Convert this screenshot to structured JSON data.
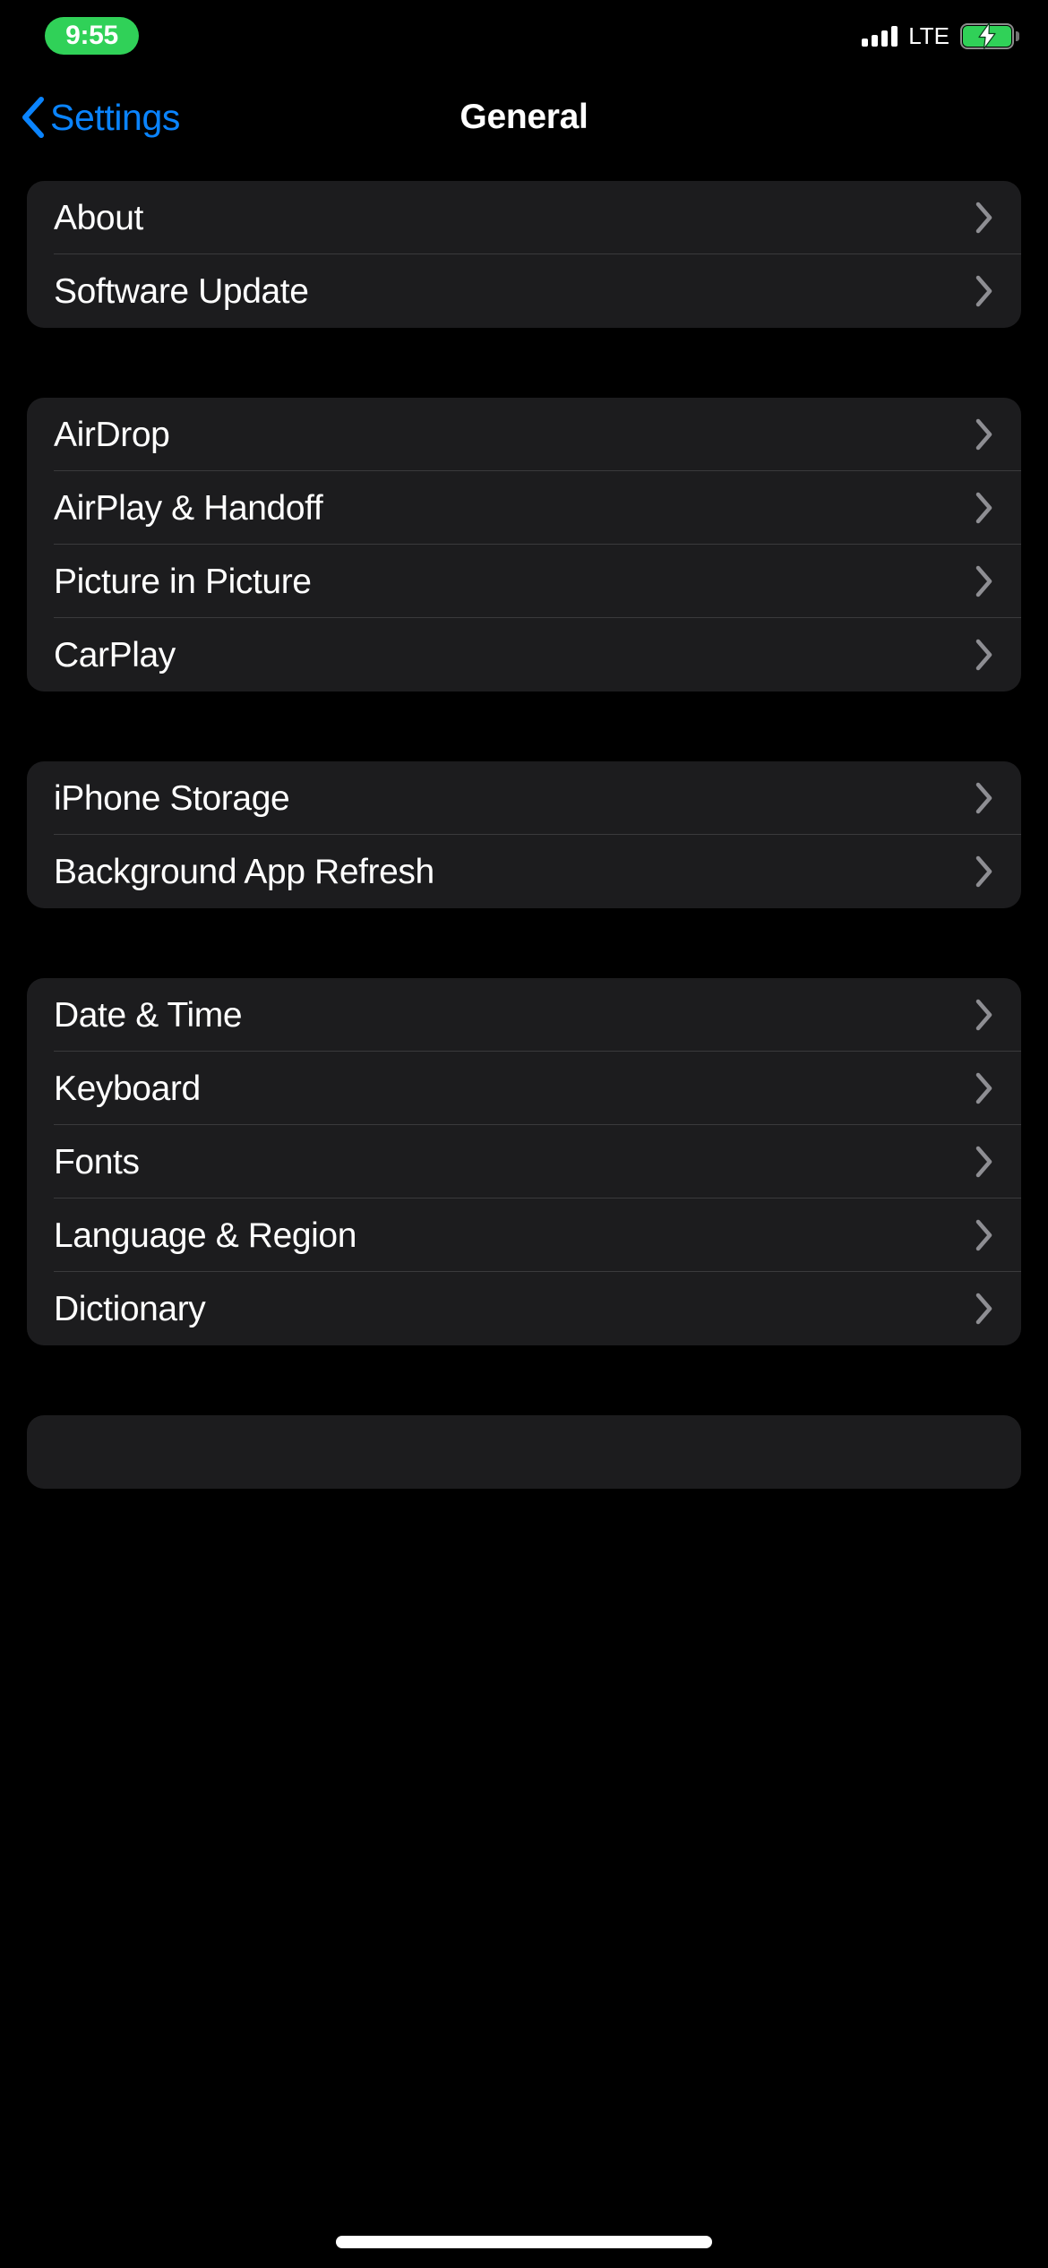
{
  "status_bar": {
    "time": "9:55",
    "time_pill_color": "#30D158",
    "carrier_tech": "LTE",
    "signal_bars": 4,
    "battery_charging": true,
    "battery_color": "#30D158"
  },
  "nav": {
    "back_label": "Settings",
    "title": "General",
    "accent_color": "#0A84FF"
  },
  "colors": {
    "background": "#000000",
    "card": "#1C1C1E",
    "separator": "#3A3A3C",
    "chevron": "#8E8E93",
    "label": "#FFFFFF"
  },
  "groups": [
    {
      "rows": [
        {
          "label": "About",
          "accessory": "chevron-right-icon"
        },
        {
          "label": "Software Update",
          "accessory": "chevron-right-icon"
        }
      ]
    },
    {
      "rows": [
        {
          "label": "AirDrop",
          "accessory": "chevron-right-icon"
        },
        {
          "label": "AirPlay & Handoff",
          "accessory": "chevron-right-icon"
        },
        {
          "label": "Picture in Picture",
          "accessory": "chevron-right-icon"
        },
        {
          "label": "CarPlay",
          "accessory": "chevron-right-icon"
        }
      ]
    },
    {
      "rows": [
        {
          "label": "iPhone Storage",
          "accessory": "chevron-right-icon"
        },
        {
          "label": "Background App Refresh",
          "accessory": "chevron-right-icon"
        }
      ]
    },
    {
      "rows": [
        {
          "label": "Date & Time",
          "accessory": "chevron-right-icon"
        },
        {
          "label": "Keyboard",
          "accessory": "chevron-right-icon"
        },
        {
          "label": "Fonts",
          "accessory": "chevron-right-icon"
        },
        {
          "label": "Language & Region",
          "accessory": "chevron-right-icon"
        },
        {
          "label": "Dictionary",
          "accessory": "chevron-right-icon"
        }
      ]
    },
    {
      "rows": []
    }
  ]
}
